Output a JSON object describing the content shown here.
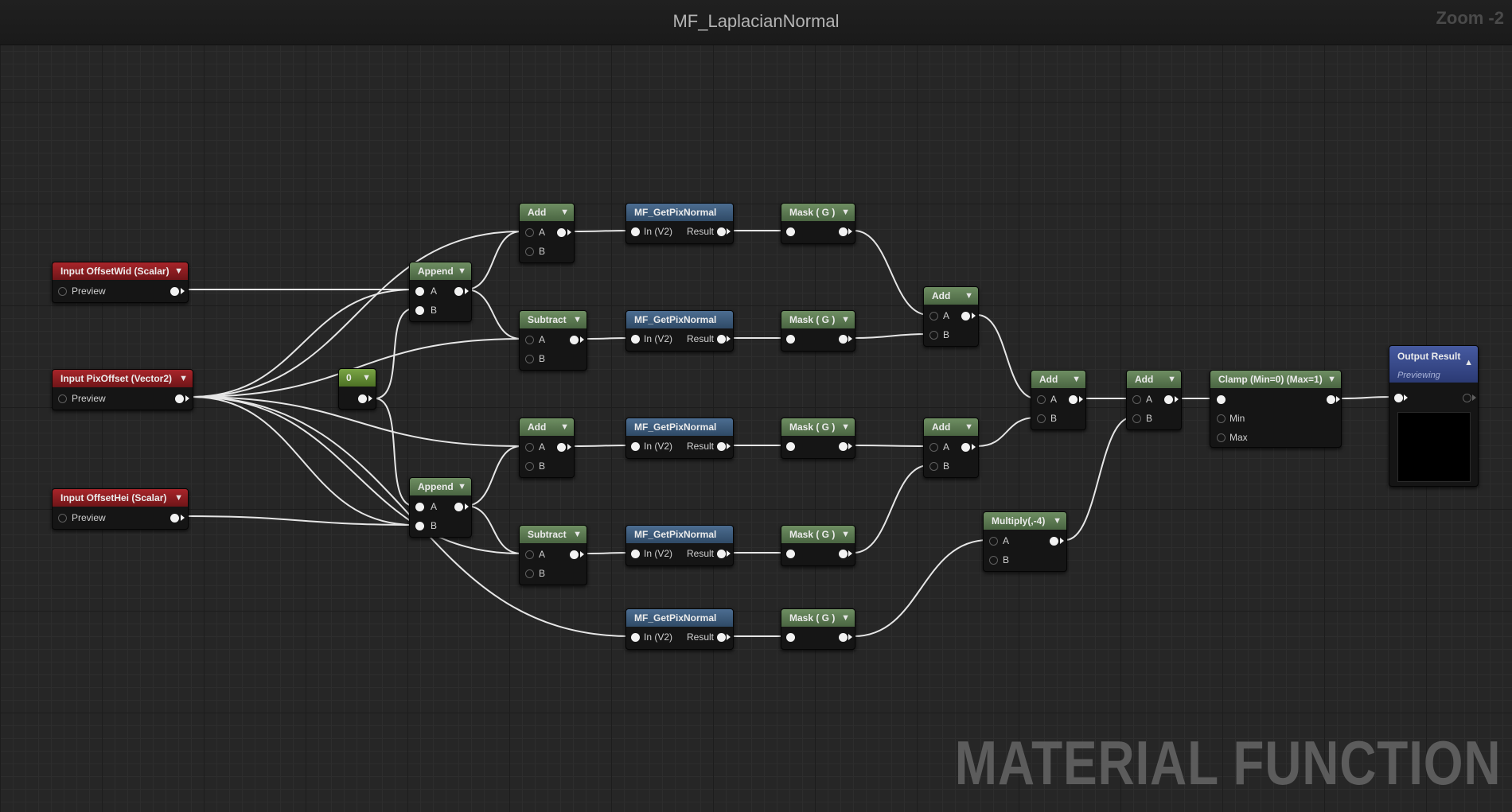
{
  "header": {
    "title": "MF_LaplacianNormal",
    "zoom": "Zoom -2"
  },
  "watermark": "MATERIAL FUNCTION",
  "colors": {
    "wire": "#e6e6e6",
    "input_header": "#a8252a",
    "math_header": "#5e7b54",
    "function_header": "#3e5a7a",
    "output_header": "#3a4c8c",
    "constant_header": "#6a9a38"
  },
  "nodes": {
    "input_offsetwid": {
      "title": "Input OffsetWid (Scalar)",
      "preview": "Preview"
    },
    "input_pixoffset": {
      "title": "Input PixOffset (Vector2)",
      "preview": "Preview"
    },
    "input_offsethei": {
      "title": "Input OffsetHei (Scalar)",
      "preview": "Preview"
    },
    "const_zero": {
      "title": "0"
    },
    "append_top": {
      "title": "Append",
      "a": "A",
      "b": "B"
    },
    "append_bottom": {
      "title": "Append",
      "a": "A",
      "b": "B"
    },
    "add_1": {
      "title": "Add",
      "a": "A",
      "b": "B"
    },
    "subtract_1": {
      "title": "Subtract",
      "a": "A",
      "b": "B"
    },
    "add_2": {
      "title": "Add",
      "a": "A",
      "b": "B"
    },
    "subtract_2": {
      "title": "Subtract",
      "a": "A",
      "b": "B"
    },
    "getpix_1": {
      "title": "MF_GetPixNormal",
      "in": "In (V2)",
      "out": "Result"
    },
    "getpix_2": {
      "title": "MF_GetPixNormal",
      "in": "In (V2)",
      "out": "Result"
    },
    "getpix_3": {
      "title": "MF_GetPixNormal",
      "in": "In (V2)",
      "out": "Result"
    },
    "getpix_4": {
      "title": "MF_GetPixNormal",
      "in": "In (V2)",
      "out": "Result"
    },
    "getpix_5": {
      "title": "MF_GetPixNormal",
      "in": "In (V2)",
      "out": "Result"
    },
    "mask_1": {
      "title": "Mask ( G )"
    },
    "mask_2": {
      "title": "Mask ( G )"
    },
    "mask_3": {
      "title": "Mask ( G )"
    },
    "mask_4": {
      "title": "Mask ( G )"
    },
    "mask_5": {
      "title": "Mask ( G )"
    },
    "add_3": {
      "title": "Add",
      "a": "A",
      "b": "B"
    },
    "add_4": {
      "title": "Add",
      "a": "A",
      "b": "B"
    },
    "add_5": {
      "title": "Add",
      "a": "A",
      "b": "B"
    },
    "add_6": {
      "title": "Add",
      "a": "A",
      "b": "B"
    },
    "multiply": {
      "title": "Multiply(,-4)",
      "a": "A",
      "b": "B"
    },
    "clamp": {
      "title": "Clamp (Min=0) (Max=1)",
      "min": "Min",
      "max": "Max"
    },
    "output": {
      "title": "Output Result",
      "subtitle": "Previewing"
    }
  }
}
